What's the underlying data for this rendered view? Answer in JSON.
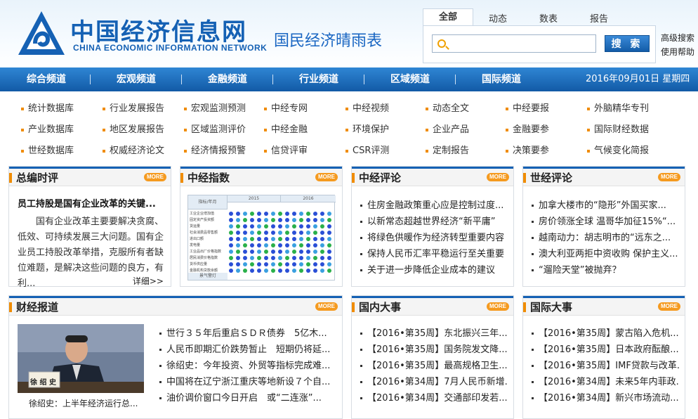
{
  "header": {
    "brand_cn": "中国经济信息网",
    "brand_en": "CHINA ECONOMIC INFORMATION NETWORK",
    "slogan": "国民经济晴雨表"
  },
  "search": {
    "tabs": [
      "全部",
      "动态",
      "数表",
      "报告"
    ],
    "placeholder": "",
    "button_label": "搜 索",
    "advanced": "高级搜索",
    "help": "使用帮助"
  },
  "nav": {
    "items": [
      "综合频道",
      "宏观频道",
      "金融频道",
      "行业频道",
      "区域频道",
      "国际频道"
    ],
    "date": "2016年09月01日 星期四"
  },
  "links": [
    [
      "统计数据库",
      "行业发展报告",
      "宏观监测预测",
      "中经专网",
      "中经视频",
      "动态全文",
      "中经要报",
      "外脑精华专刊"
    ],
    [
      "产业数据库",
      "地区发展报告",
      "区域监测评价",
      "中经金融",
      "环境保护",
      "企业产品",
      "金融要参",
      "国际财经数据"
    ],
    [
      "世经数据库",
      "权威经济论文",
      "经济情报预警",
      "信贷评审",
      "CSR评测",
      "定制报告",
      "决策要参",
      "气候变化简报"
    ]
  ],
  "more_label": "MORE",
  "panels": {
    "editorial": {
      "title": "总编时评",
      "headline": "员工持股是国有企业改革的关键...",
      "body": "国有企业改革主要要解决贪腐、低效、可持续发展三大问题。国有企业员工持股改革举措，克服所有者缺位难题，是解决这些问题的良方，有利...",
      "more": "详细>>"
    },
    "index": {
      "title": "中经指数",
      "header_label": "指标/年月",
      "year1": "2015",
      "year2": "2016",
      "footer_label": "景气警灯",
      "rows": [
        "工业企业增加值",
        "固定资产投资额",
        "货运量",
        "社会消费品零售额",
        "进出口额",
        "发电量",
        "工业品出厂价格指数",
        "居民消费价格指数",
        "货币供应量",
        "金融机构贷款余额"
      ]
    },
    "commentary": {
      "title": "中经评论",
      "items": [
        "住房金融政策重心应是控制过度...",
        "以新常态超越世界经济“新平庸”",
        "将绿色供暖作为经济转型重要内容",
        "保持人民币汇率平稳运行至关重要",
        "关于进一步降低企业成本的建议"
      ]
    },
    "world_commentary": {
      "title": "世经评论",
      "items": [
        "加拿大楼市的“隐形”外国买家...",
        "房价领涨全球 温哥华加征15%“...",
        "越南动力：胡志明市的“远东之...",
        "澳大利亚两拒中资收购 保护主义...",
        "“遛险天堂”被抛弃？"
      ]
    },
    "finance": {
      "title": "财经报道",
      "photo_caption": "徐绍史：上半年经济运行总...",
      "photo_nameplate": "徐 绍 史",
      "items": [
        "世行３５年后重启ＳＤＲ债券　5亿木...",
        "人民币即期汇价跌势暂止　短期仍将延...",
        "徐绍史：今年投资、外贸等指标完成难...",
        "中国将在辽宁浙江重庆等地新设７个自...",
        "油价调价窗口今日开启　或“二连涨”..."
      ]
    },
    "domestic": {
      "title": "国内大事",
      "items": [
        "【2016•第35周】东北振兴三年...",
        "【2016•第35周】国务院发文降...",
        "【2016•第35周】最高规格卫生...",
        "【2016•第34周】7月人民币新增...",
        "【2016•第34周】交通部印发若..."
      ]
    },
    "international": {
      "title": "国际大事",
      "items": [
        "【2016•第35周】蒙古陷入危机...",
        "【2016•第35周】日本政府酝酿...",
        "【2016•第35周】IMF贷款与改革...",
        "【2016•第34周】未来5年内菲政...",
        "【2016•第34周】新兴市场流动..."
      ]
    }
  },
  "colors": {
    "brand_blue": "#1561b4",
    "nav_blue": "#2f86d4",
    "accent_orange": "#f59a1f"
  }
}
